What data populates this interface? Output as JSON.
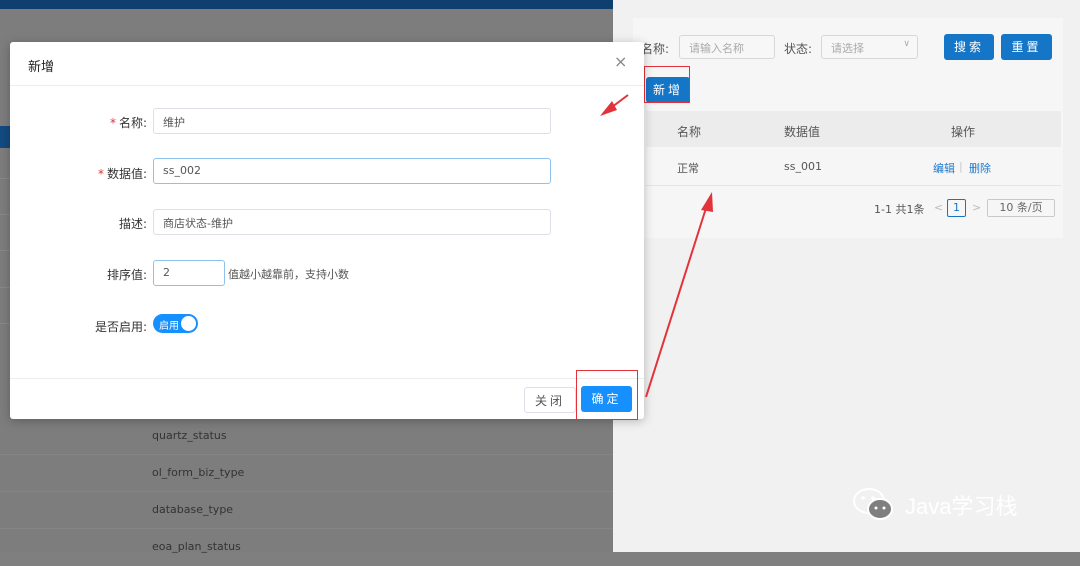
{
  "background_list": {
    "rows": [
      "quartz_status",
      "ol_form_biz_type",
      "database_type",
      "eoa_plan_status"
    ]
  },
  "drawer": {
    "search": {
      "name_label": "名称:",
      "name_placeholder": "请输入名称",
      "status_label": "状态:",
      "status_placeholder": "请选择",
      "search_button": "搜索",
      "reset_button": "重置"
    },
    "add_button": "新增",
    "table": {
      "headers": [
        "名称",
        "数据值",
        "操作"
      ],
      "rows": [
        {
          "name": "正常",
          "value": "ss_001",
          "edit": "编辑",
          "separator": "|",
          "delete": "删除"
        }
      ]
    },
    "pagination": {
      "summary": "1-1 共1条",
      "prev": "<",
      "page": "1",
      "next": ">",
      "page_size": "10 条/页"
    }
  },
  "modal": {
    "title": "新增",
    "close_glyph": "×",
    "fields": {
      "name": {
        "required_mark": "*",
        "label": "名称:",
        "value": "维护"
      },
      "data_value": {
        "required_mark": "*",
        "label": "数据值:",
        "value": "ss_002"
      },
      "description": {
        "label": "描述:",
        "value": "商店状态-维护"
      },
      "sort": {
        "label": "排序值:",
        "value": "2",
        "hint": "值越小越靠前，支持小数"
      },
      "enabled": {
        "label": "是否启用:",
        "switch_text": "启用",
        "on": true
      }
    },
    "cancel_button": "关闭",
    "ok_button": "确定"
  },
  "watermark": {
    "text": "Java学习栈"
  },
  "colors": {
    "primary": "#1790ff",
    "annotation_red": "#e3333a",
    "overlay": "#7f7f7f"
  }
}
